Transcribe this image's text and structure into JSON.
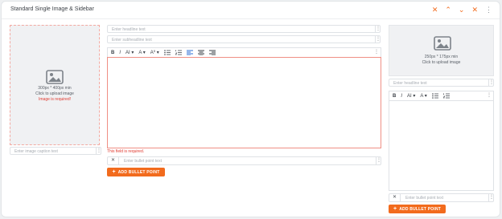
{
  "header": {
    "title": "Standard Single Image & Sidebar"
  },
  "icons": {
    "close": "✕",
    "up": "⌃",
    "down": "⌄",
    "remove": "✕",
    "more": "⋮",
    "image": "image-icon"
  },
  "main_image": {
    "size_hint": "300px * 400px min",
    "upload_text": "Click to upload image",
    "error": "Image is required!"
  },
  "caption": {
    "placeholder": "Enter image caption text"
  },
  "headline": {
    "placeholder": "Enter headline text"
  },
  "subheadline": {
    "placeholder": "Enter subheadline text"
  },
  "toolbar": {
    "bold": "B",
    "italic": "I",
    "font_size": "AI ▾",
    "font_color": "A ▾",
    "text_style": "A⁰ ▾"
  },
  "editor": {
    "error": "This field is required."
  },
  "bullets": {
    "placeholder": "Enter bullet point text",
    "add_label": "ADD BULLET POINT"
  },
  "sidebar_image": {
    "size_hint": "250px * 175px min",
    "upload_text": "Click to upload image"
  },
  "sidebar_headline": {
    "placeholder": "Enter headline text"
  },
  "sidebar_bullets": {
    "placeholder": "Enter bullet point text",
    "add_label": "ADD BULLET POINT"
  },
  "colors": {
    "accent": "#f26b1d",
    "error": "#e0392f",
    "active": "#2d6fd6"
  }
}
